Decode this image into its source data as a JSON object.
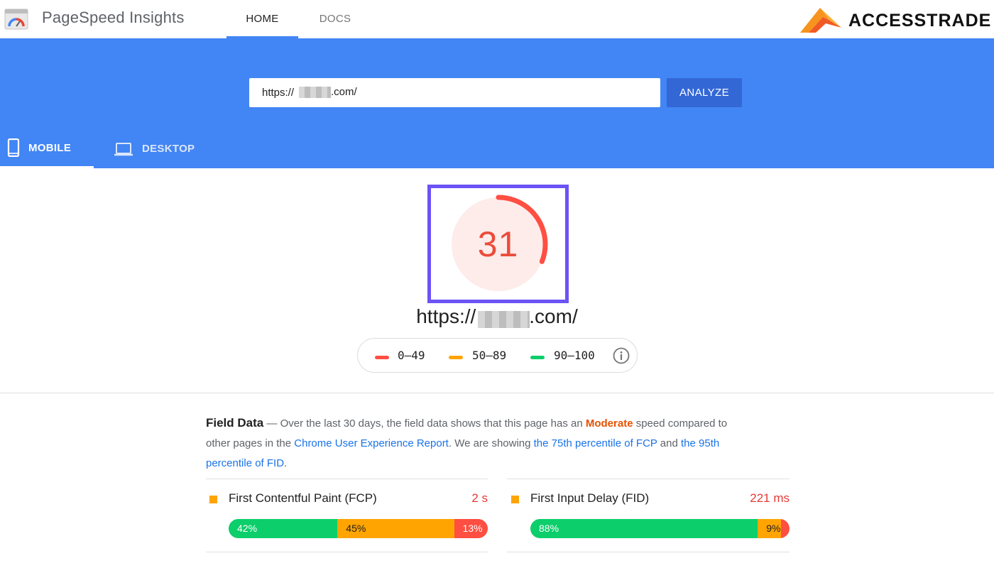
{
  "header": {
    "app_title": "PageSpeed Insights",
    "nav": [
      {
        "label": "HOME",
        "active": true
      },
      {
        "label": "DOCS",
        "active": false
      }
    ],
    "brand": "ACCESSTRADE"
  },
  "search": {
    "url_prefix": "https://",
    "url_suffix": ".com/",
    "analyze_label": "ANALYZE"
  },
  "device_tabs": [
    {
      "label": "MOBILE",
      "icon": "phone-icon",
      "active": true
    },
    {
      "label": "DESKTOP",
      "icon": "laptop-icon",
      "active": false
    }
  ],
  "score": {
    "value": "31",
    "fraction": 0.31,
    "page_url_prefix": "https://",
    "page_url_suffix": ".com/"
  },
  "legend": {
    "items": [
      {
        "label": "0–49",
        "color": "#ff4e42"
      },
      {
        "label": "50–89",
        "color": "#ffa400"
      },
      {
        "label": "90–100",
        "color": "#0cce6b"
      }
    ],
    "info_icon": "info-icon"
  },
  "field_data": {
    "title": "Field Data",
    "text_1": " — Over the last 30 days, the field data shows that this page has an ",
    "speed": "Moderate",
    "text_2": " speed compared to other pages in the ",
    "link_report": "Chrome User Experience Report",
    "text_3": ". We are showing ",
    "link_fcp": "the 75th percentile of FCP",
    "text_4": " and ",
    "link_fid": "the 95th percentile of FID",
    "text_5": "."
  },
  "metrics": [
    {
      "name": "First Contentful Paint (FCP)",
      "value": "2 s",
      "fast": 42,
      "average": 45,
      "slow": 13,
      "fast_label": "42%",
      "average_label": "45%",
      "slow_label": "13%"
    },
    {
      "name": "First Input Delay (FID)",
      "value": "221 ms",
      "fast": 88,
      "average": 9,
      "slow": 3,
      "fast_label": "88%",
      "average_label": "9%",
      "slow_label": "3%"
    }
  ],
  "colors": {
    "accent_blue": "#4285f4",
    "fail": "#ff4e42",
    "average": "#ffa400",
    "pass": "#0cce6b",
    "highlight_frame": "#6b53f5"
  }
}
